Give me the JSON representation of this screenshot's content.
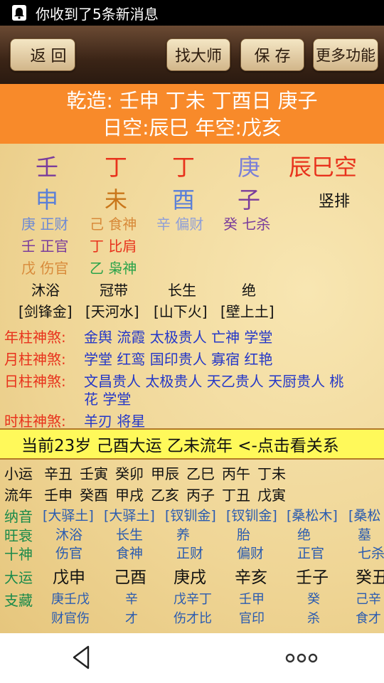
{
  "status": {
    "message": "你收到了5条新消息"
  },
  "toolbar": {
    "back": "返 回",
    "master": "找大师",
    "save": "保 存",
    "more": "更多功能"
  },
  "header": {
    "line1": "乾造: 壬申 丁未 丁酉日 庚子",
    "line2": "日空:辰巳 年空:戊亥"
  },
  "stems": [
    "壬",
    "丁",
    "丁",
    "庚"
  ],
  "void_label": "辰巳空",
  "branches": [
    "申",
    "未",
    "酉",
    "子"
  ],
  "vertical_label": "竖排",
  "hidden": [
    [
      "庚 正财",
      "己 食神",
      "辛 偏财",
      "癸 七杀"
    ],
    [
      "壬 正官",
      "丁 比肩"
    ],
    [
      "戊 伤官",
      "乙 枭神"
    ]
  ],
  "life_stage": [
    "沐浴",
    "冠带",
    "长生",
    "绝"
  ],
  "nayin": [
    "[剑锋金]",
    "[天河水]",
    "[山下火]",
    "[壁上土]"
  ],
  "shensha": [
    {
      "label": "年柱神煞:",
      "text": "金舆 流霞 太极贵人 亡神 学堂"
    },
    {
      "label": "月柱神煞:",
      "text": "学堂 红鸾 国印贵人 寡宿 红艳"
    },
    {
      "label": "日柱神煞:",
      "text": "文昌贵人 太极贵人 天乙贵人 天厨贵人 桃",
      "text2": "花 学堂"
    },
    {
      "label": "时柱神煞:",
      "text": "羊刃 将星"
    }
  ],
  "current_bar": "当前23岁 己酉大运 乙未流年   <-点击看关系",
  "xiaoyun": {
    "label": "小运",
    "values": [
      "辛丑",
      "壬寅",
      "癸卯",
      "甲辰",
      "乙巳",
      "丙午",
      "丁未"
    ]
  },
  "liunian": {
    "label": "流年",
    "values": [
      "壬申",
      "癸酉",
      "甲戌",
      "乙亥",
      "丙子",
      "丁丑",
      "戊寅"
    ]
  },
  "nayin_row": {
    "label": "纳音",
    "values": [
      "[大驿土]",
      "[大驿土]",
      "[钗钏金]",
      "[钗钏金]",
      "[桑松木]",
      "[桑松"
    ]
  },
  "wangshuai_row": {
    "label": "旺衰",
    "values": [
      "沐浴",
      "长生",
      "养",
      "胎",
      "绝",
      "墓"
    ]
  },
  "shishen_row": {
    "label": "十神",
    "values": [
      "伤官",
      "食神",
      "正财",
      "偏财",
      "正官",
      "七杀"
    ]
  },
  "dayun_row": {
    "label": "大运",
    "values": [
      "戊申",
      "己酉",
      "庚戌",
      "辛亥",
      "壬子",
      "癸丑"
    ]
  },
  "zhicang_row": {
    "label": "支藏",
    "line1": [
      "庚壬戊",
      "辛",
      "戊辛丁",
      "壬甲",
      "癸",
      "己辛"
    ],
    "line2": [
      "财官伤",
      "才",
      "伤才比",
      "官印",
      "杀",
      "食才"
    ]
  },
  "colors": {
    "orange": "#f88a2a",
    "yellowbar": "#fff95a",
    "red": "#e8321c",
    "blue": "#2437c8",
    "purple": "#7a3c9c",
    "green": "#1a8a4a"
  }
}
